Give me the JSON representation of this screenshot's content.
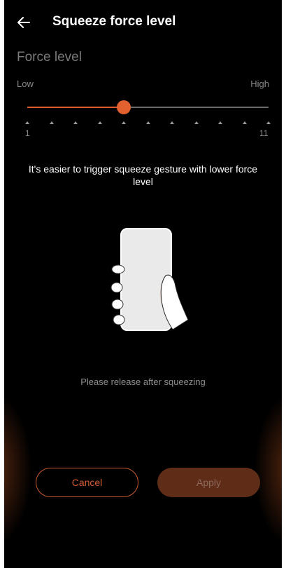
{
  "header": {
    "title": "Squeeze force level",
    "back_icon": "arrow-left-icon"
  },
  "section": {
    "title": "Force level"
  },
  "slider": {
    "low_label": "Low",
    "high_label": "High",
    "min": 1,
    "max": 11,
    "value": 5,
    "min_label": "1",
    "max_label": "11",
    "accent_color": "#e3612f"
  },
  "hint": "It's easier to trigger squeeze gesture with lower force level",
  "illustration": {
    "icon": "hand-squeezing-phone-icon"
  },
  "status": "Please release after squeezing",
  "buttons": {
    "cancel_label": "Cancel",
    "apply_label": "Apply"
  },
  "colors": {
    "background": "#000000",
    "accent": "#e3612f",
    "apply_bg": "#5e2c17"
  }
}
